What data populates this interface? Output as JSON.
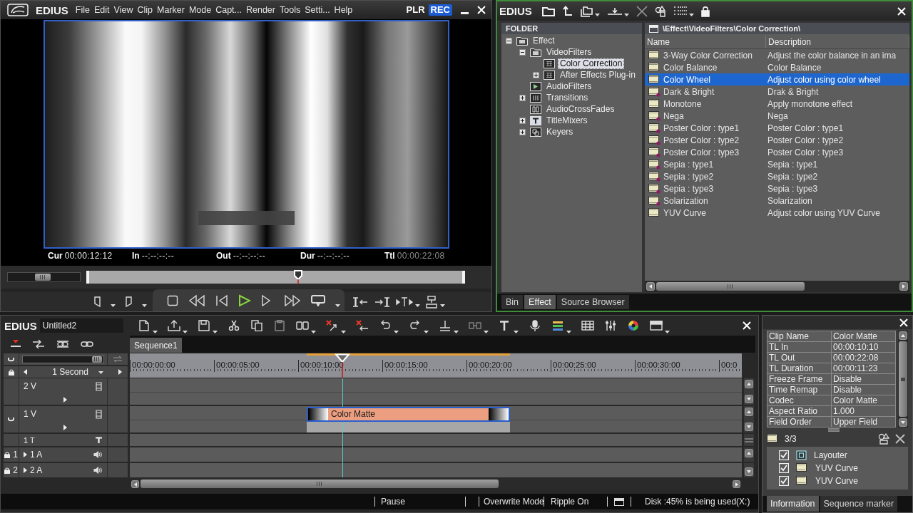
{
  "player": {
    "logo": "EDIUS",
    "menu": [
      "File",
      "Edit",
      "View",
      "Clip",
      "Marker",
      "Mode",
      "Capt...",
      "Render",
      "Tools",
      "Setti...",
      "Help"
    ],
    "modes": [
      {
        "label": "PLR",
        "selected": false
      },
      {
        "label": "REC",
        "selected": true
      }
    ],
    "timecodes": [
      {
        "label": "Cur",
        "value": "00:00:12:12",
        "dimmed": false
      },
      {
        "label": "In",
        "value": "--:--:--:--",
        "dimmed": false
      },
      {
        "label": "Out",
        "value": "--:--:--:--",
        "dimmed": false
      },
      {
        "label": "Dur",
        "value": "--:--:--:--",
        "dimmed": false
      },
      {
        "label": "Ttl",
        "value": "00:00:22:08",
        "dimmed": true
      }
    ],
    "shuttle": {
      "level": 0.49
    },
    "position": {
      "level": 0.56
    }
  },
  "bin": {
    "logo": "EDIUS",
    "folder_header": "FOLDER",
    "tree": [
      {
        "label": "Effect",
        "kind": "folder",
        "expanded": true,
        "selected": false,
        "children": [
          {
            "label": "VideoFilters",
            "kind": "folder",
            "expanded": true,
            "selected": false,
            "children": [
              {
                "label": "Color Correction",
                "kind": "filter-group",
                "selected": true
              },
              {
                "label": "After Effects Plug-in",
                "kind": "filter-group",
                "expanded": false,
                "selected": false
              }
            ]
          },
          {
            "label": "AudioFilters",
            "kind": "audio",
            "selected": false
          },
          {
            "label": "Transitions",
            "kind": "transition",
            "expanded": false,
            "selected": false
          },
          {
            "label": "AudioCrossFades",
            "kind": "crossfade",
            "selected": false
          },
          {
            "label": "TitleMixers",
            "kind": "title",
            "expanded": false,
            "selected": false
          },
          {
            "label": "Keyers",
            "kind": "keyer",
            "expanded": false,
            "selected": false
          }
        ]
      }
    ],
    "path": "\\Effect\\VideoFilters\\Color Correction\\",
    "columns": [
      "Name",
      "Description"
    ],
    "rows": [
      {
        "name": "3-Way Color Correction",
        "description": "Adjust the color balance in an ima",
        "marked": false,
        "selected": false
      },
      {
        "name": "Color Balance",
        "description": "Color Balance",
        "marked": false,
        "selected": false
      },
      {
        "name": "Color Wheel",
        "description": "Adjust color using color wheel",
        "marked": false,
        "selected": true
      },
      {
        "name": "Dark & Bright",
        "description": "Drak & Bright",
        "marked": true,
        "selected": false
      },
      {
        "name": "Monotone",
        "description": "Apply monotone effect",
        "marked": false,
        "selected": false
      },
      {
        "name": "Nega",
        "description": "Nega",
        "marked": true,
        "selected": false
      },
      {
        "name": "Poster Color : type1",
        "description": "Poster Color : type1",
        "marked": true,
        "selected": false
      },
      {
        "name": "Poster Color : type2",
        "description": "Poster Color : type2",
        "marked": true,
        "selected": false
      },
      {
        "name": "Poster Color : type3",
        "description": "Poster Color : type3",
        "marked": true,
        "selected": false
      },
      {
        "name": "Sepia : type1",
        "description": "Sepia : type1",
        "marked": true,
        "selected": false
      },
      {
        "name": "Sepia : type2",
        "description": "Sepia : type2",
        "marked": true,
        "selected": false
      },
      {
        "name": "Sepia : type3",
        "description": "Sepia : type3",
        "marked": true,
        "selected": false
      },
      {
        "name": "Solarization",
        "description": "Solarization",
        "marked": true,
        "selected": false
      },
      {
        "name": "YUV Curve",
        "description": "Adjust color using YUV Curve",
        "marked": false,
        "selected": false
      }
    ],
    "tabs": [
      {
        "label": "Bin",
        "selected": false
      },
      {
        "label": "Effect",
        "selected": true
      },
      {
        "label": "Source Browser",
        "selected": false
      }
    ]
  },
  "timeline": {
    "logo": "EDIUS",
    "project_name": "Untitled2",
    "sequence_tabs": [
      {
        "label": "Sequence1",
        "selected": true
      }
    ],
    "zoom_slider": {
      "level": 0.92
    },
    "zoom_unit": "1 Second",
    "ruler": [
      "00:00:00:00",
      "00:00:05:00",
      "00:00:10:00",
      "00:00:15:00",
      "00:00:20:00",
      "00:00:25:00",
      "00:00:30:00",
      "00:0"
    ],
    "playhead": {
      "level": 0.347
    },
    "tracks": [
      {
        "label": "2 V",
        "kind": "video",
        "patched": false
      },
      {
        "label": "1 V",
        "kind": "video",
        "patched": true,
        "clips": [
          {
            "name": "Color Matte",
            "selected": true
          }
        ]
      },
      {
        "label": "1 T",
        "kind": "title",
        "patched": false
      },
      {
        "label": "1 A",
        "kind": "audio",
        "patched": true,
        "channel": "1"
      },
      {
        "label": "2 A",
        "kind": "audio",
        "patched": true,
        "channel": "2"
      }
    ],
    "status": [
      "Pause",
      "Overwrite Mode",
      "Ripple On",
      "Disk :45% is being used(X:)"
    ]
  },
  "info": {
    "rows": [
      {
        "label": "Clip Name",
        "value": "Color Matte"
      },
      {
        "label": "TL In",
        "value": "00:00:10:10"
      },
      {
        "label": "TL Out",
        "value": "00:00:22:08"
      },
      {
        "label": "TL Duration",
        "value": "00:00:11:23"
      },
      {
        "label": "Freeze Frame",
        "value": "Disable"
      },
      {
        "label": "Time Remap",
        "value": "Disable"
      },
      {
        "label": "Codec",
        "value": "Color Matte"
      },
      {
        "label": "Aspect Ratio",
        "value": "1.000"
      },
      {
        "label": "Field Order",
        "value": "Upper Field"
      }
    ],
    "filter_count": "3/3",
    "filters": [
      {
        "name": "Layouter",
        "kind": "layouter",
        "checked": true
      },
      {
        "name": "YUV Curve",
        "kind": "filter",
        "checked": true
      },
      {
        "name": "YUV Curve",
        "kind": "filter",
        "checked": true
      }
    ],
    "tabs": [
      {
        "label": "Information",
        "selected": true
      },
      {
        "label": "Sequence marker",
        "selected": false
      }
    ]
  }
}
